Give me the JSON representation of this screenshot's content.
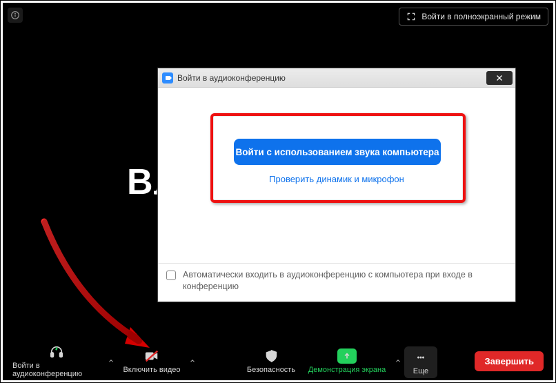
{
  "header": {
    "fullscreen_label": "Войти в полноэкранный режим"
  },
  "background": {
    "partial_text": "Вл"
  },
  "dialog": {
    "title": "Войти в аудиоконференцию",
    "primary_button": "Войти с использованием звука компьютера",
    "test_link": "Проверить динамик и микрофон",
    "auto_join_label": "Автоматически входить в аудиоконференцию с компьютера при входе в конференцию"
  },
  "toolbar": {
    "audio_label": "Войти в аудиоконференцию",
    "video_label": "Включить видео",
    "security_label": "Безопасность",
    "share_label": "Демонстрация экрана",
    "more_label": "Еще",
    "end_label": "Завершить"
  }
}
